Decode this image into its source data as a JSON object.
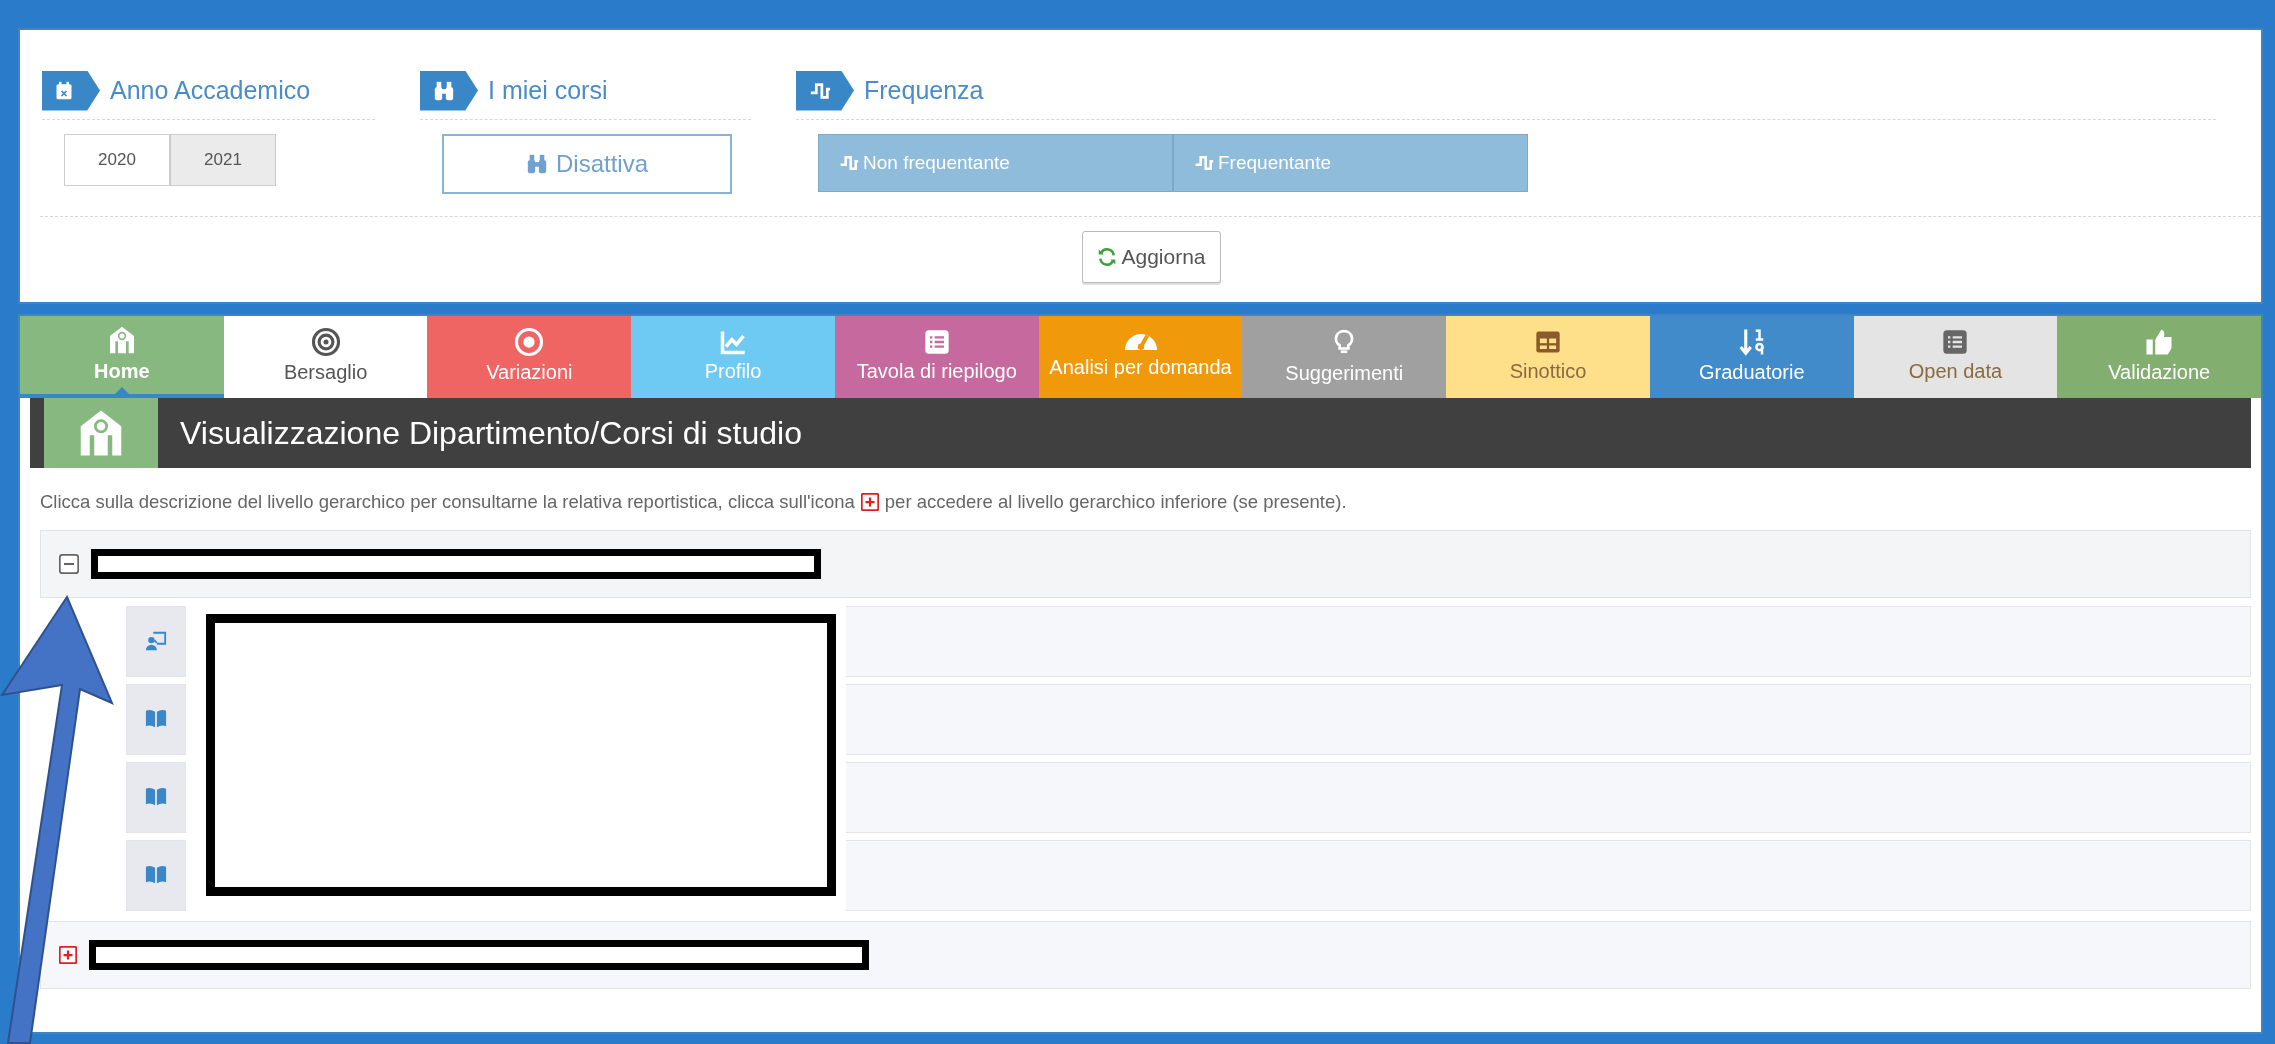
{
  "filters": [
    {
      "kind": "years",
      "title": "Anno Accademico",
      "options": [
        {
          "label": "2020",
          "selected": false
        },
        {
          "label": "2021",
          "selected": true
        }
      ]
    },
    {
      "kind": "toggle",
      "title": "I miei corsi",
      "button": "Disattiva"
    },
    {
      "kind": "attendance",
      "title": "Frequenza",
      "options": [
        {
          "label": "Non frequentante",
          "selected": false
        },
        {
          "label": "Frequentante",
          "selected": false
        }
      ]
    }
  ],
  "refresh_button": "Aggiorna",
  "nav_tabs": [
    {
      "label": "Home",
      "color": "#87b87f",
      "selected": true
    },
    {
      "label": "Bersaglio",
      "color": "#ffffff",
      "selected": false
    },
    {
      "label": "Variazioni",
      "color": "#ee6564",
      "selected": false
    },
    {
      "label": "Profilo",
      "color": "#6fcaf3",
      "selected": false
    },
    {
      "label": "Tavola di riepilogo",
      "color": "#c6699f",
      "selected": false
    },
    {
      "label": "Analisi per domanda",
      "color": "#f09a0b",
      "selected": false
    },
    {
      "label": "Suggerimenti",
      "color": "#a0a0a0",
      "selected": false
    },
    {
      "label": "Sinottico",
      "color": "#fee08b",
      "selected": false
    },
    {
      "label": "Graduatorie",
      "color": "#428bca",
      "selected": false
    },
    {
      "label": "Open data",
      "color": "#e4e4e4",
      "selected": false
    },
    {
      "label": "Validazione",
      "color": "#82af6f",
      "selected": false
    }
  ],
  "section": {
    "title": "Visualizzazione Dipartimento/Corsi di studio",
    "instruction_before": "Clicca sulla descrizione del livello gerarchico per consultarne la relativa reportistica, clicca sull'icona",
    "instruction_after": "per accedere al livello gerarchico inferiore (se presente)."
  },
  "tree": [
    {
      "expanded": true,
      "redacted": true,
      "children_redacted": true,
      "children": [
        {
          "kind": "teaching"
        },
        {
          "kind": "book"
        },
        {
          "kind": "book"
        },
        {
          "kind": "book"
        }
      ]
    },
    {
      "expanded": false,
      "redacted": true
    }
  ],
  "annotations": [
    {
      "kind": "arrow"
    }
  ]
}
